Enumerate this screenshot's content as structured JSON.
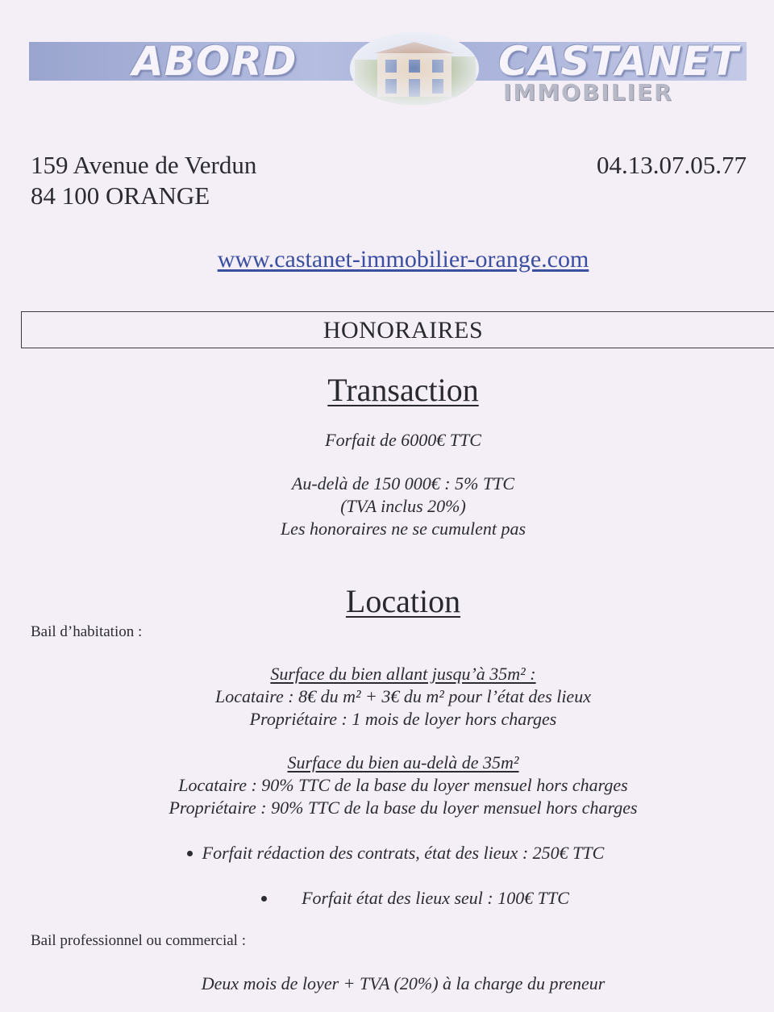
{
  "logo": {
    "word_left": "ABORD",
    "word_right": "CASTANET",
    "subtitle": "IMMOBILIER",
    "image_icon": "house-photo-icon"
  },
  "contact": {
    "address_line1": "159 Avenue de Verdun",
    "address_line2": "84 100 ORANGE",
    "phone": "04.13.07.05.77",
    "website": "www.castanet-immobilier-orange.com"
  },
  "honoraires": {
    "title": "HONORAIRES"
  },
  "transaction": {
    "heading": "Transaction",
    "forfait": "Forfait de 6000€ TTC",
    "au_dela": "Au-delà de 150 000€ : 5% TTC",
    "tva": "(TVA inclus 20%)",
    "cumul": "Les honoraires ne se cumulent pas"
  },
  "location": {
    "heading": "Location",
    "bail_habitation_label": "Bail d’habitation :",
    "small": {
      "title": "Surface du bien allant jusqu’à 35m² :",
      "locataire": "Locataire : 8€ du m² + 3€ du m² pour l’état des lieux",
      "proprietaire": "Propriétaire : 1 mois de loyer hors charges"
    },
    "large": {
      "title": "Surface du bien au-delà de 35m²",
      "locataire": "Locataire : 90% TTC de la base du loyer mensuel hors charges",
      "proprietaire": "Propriétaire : 90% TTC de la base du loyer mensuel hors charges"
    },
    "bullets": [
      "Forfait rédaction des contrats, état des lieux : 250€ TTC",
      "Forfait état des lieux seul : 100€ TTC"
    ],
    "bail_pro_label": "Bail professionnel ou commercial :",
    "bail_pro_text": "Deux mois de loyer + TVA (20%) à la charge du preneur"
  },
  "colors": {
    "paper": "#f4eef6",
    "logo_band": "#a9b2da",
    "link": "#3a4fa0",
    "text": "#2a2a2e"
  }
}
